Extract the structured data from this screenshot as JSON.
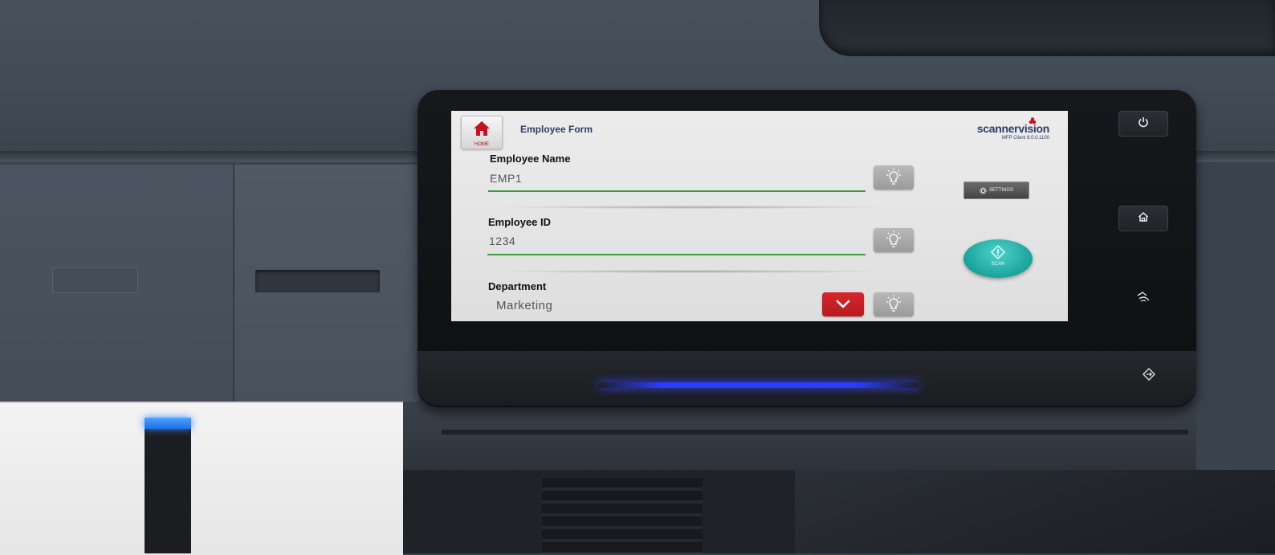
{
  "screen": {
    "home_button": {
      "label": "HOME",
      "icon": "home-icon"
    },
    "title": "Employee Form",
    "logo": {
      "brand": "scannervision",
      "subtitle": "MFP Client 8.0.0.1100"
    },
    "fields": [
      {
        "label": "Employee Name",
        "value": "EMP1"
      },
      {
        "label": "Employee ID",
        "value": "1234"
      },
      {
        "label": "Department",
        "value": "Marketing"
      }
    ],
    "settings_button": {
      "label": "SETTINGS",
      "icon": "gear-icon"
    },
    "scan_button": {
      "label": "SCAN",
      "icon": "scan-start-icon"
    }
  },
  "hardware_buttons": [
    {
      "name": "power",
      "icon": "power-icon",
      "glyph": "⏻"
    },
    {
      "name": "home",
      "icon": "home-icon",
      "glyph": "⌂"
    },
    {
      "name": "nfc",
      "icon": "nfc-icon",
      "glyph": "☞"
    },
    {
      "name": "login",
      "icon": "login-icon",
      "glyph": "⇨"
    }
  ],
  "colors": {
    "field_underline": "#3a9b3a",
    "dropdown_red": "#d8262c",
    "scan_teal": "#1aa49c",
    "brand_navy": "#2d3e66"
  }
}
